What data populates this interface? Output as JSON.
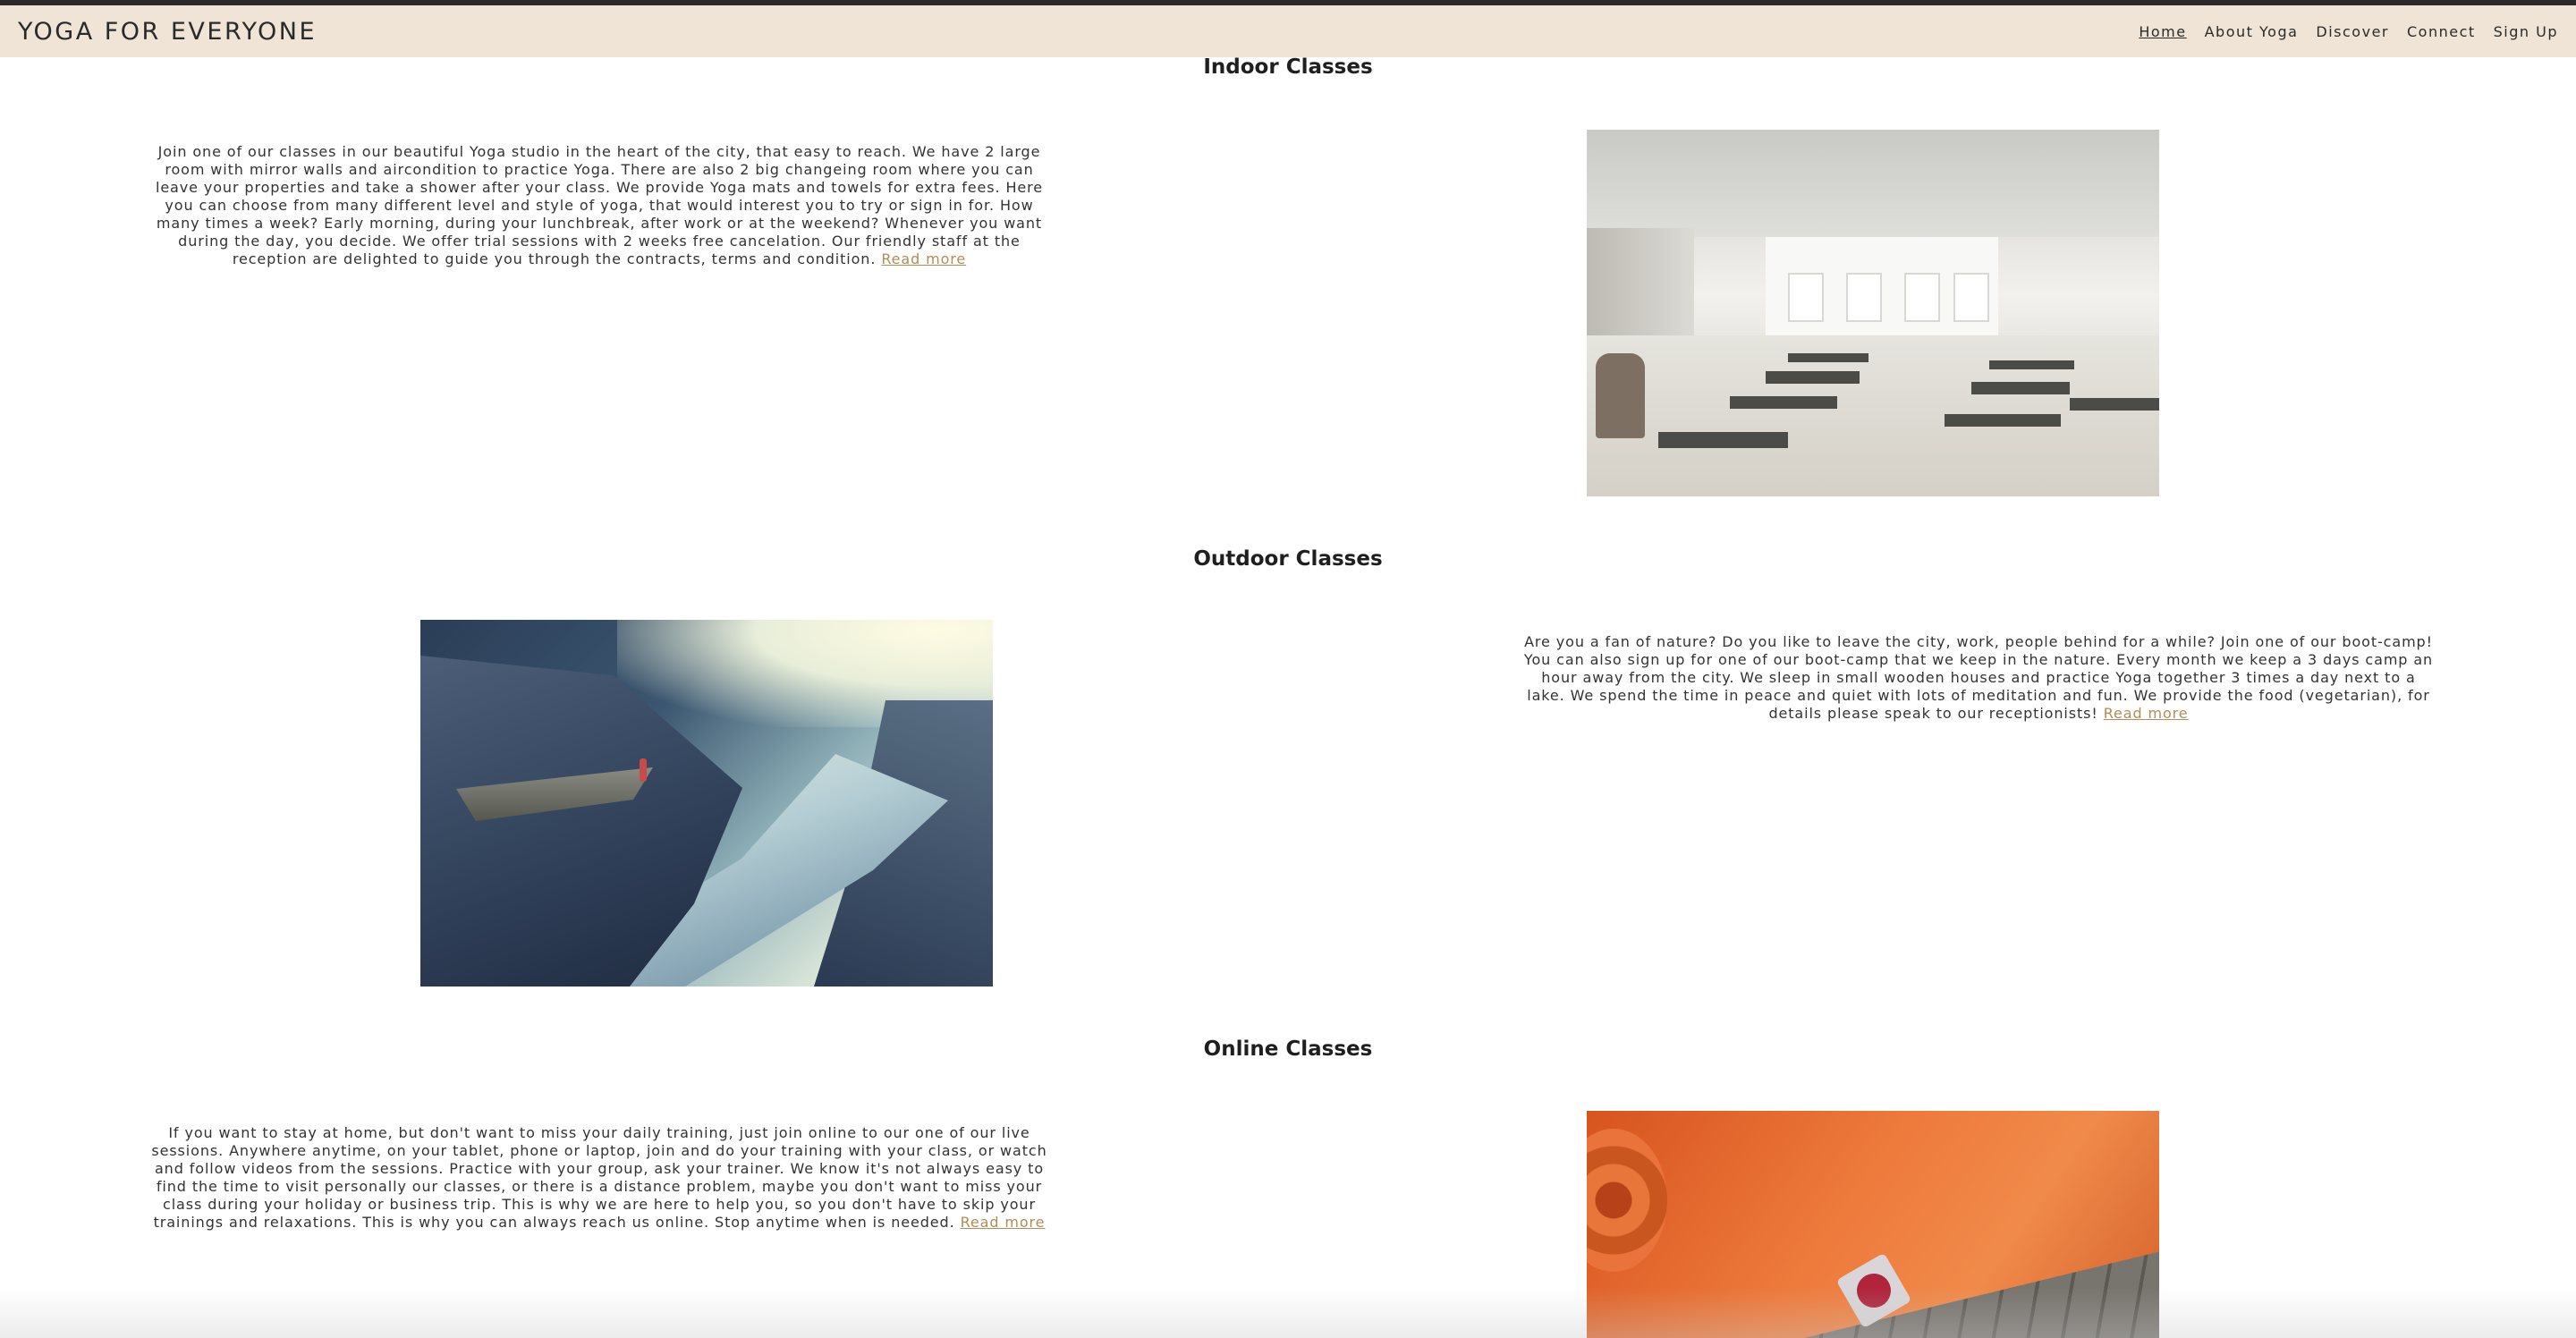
{
  "brand": "YOGA FOR EVERYONE",
  "nav": [
    {
      "label": "Home",
      "active": true
    },
    {
      "label": "About Yoga",
      "active": false
    },
    {
      "label": "Discover",
      "active": false
    },
    {
      "label": "Connect",
      "active": false
    },
    {
      "label": "Sign Up",
      "active": false
    }
  ],
  "sections": {
    "indoor": {
      "title": "Indoor Classes",
      "text": "Join one of our classes in our beautiful Yoga studio in the heart of the city, that easy to reach. We have 2 large room with mirror walls and aircondition to practice Yoga. There are also 2 big changeing room where you can leave your properties and take a shower after your class. We provide Yoga mats and towels for extra fees. Here you can choose from many different level and style of yoga, that would interest you to try or sign in for. How many times a week? Early morning, during your lunchbreak, after work or at the weekend? Whenever you want during the day, you decide. We offer trial sessions with 2 weeks free cancelation. Our friendly staff at the reception are delighted to guide you through the contracts, terms and condition.",
      "link": "Read more"
    },
    "outdoor": {
      "title": "Outdoor Classes",
      "text": "Are you a fan of nature? Do you like to leave the city, work, people behind for a while? Join one of our boot-camp! You can also sign up for one of our boot-camp that we keep in the nature. Every month we keep a 3 days camp an hour away from the city. We sleep in small wooden houses and practice Yoga together 3 times a day next to a lake. We spend the time in peace and quiet with lots of meditation and fun. We provide the food (vegetarian), for details please speak to our receptionists!",
      "link": "Read more"
    },
    "online": {
      "title": "Online Classes",
      "text": "If you want to stay at home, but don't want to miss your daily training, just join online to our one of our live sessions. Anywhere anytime, on your tablet, phone or laptop, join and do your training with your class, or watch and follow videos from the sessions. Practice with your group, ask your trainer. We know it's not always easy to find the time to visit personally our classes, or there is a distance problem, maybe you don't want to miss your class during your holiday or business trip. This is why we are here to help you, so you don't have to skip your trainings and relaxations. This is why you can always reach us online. Stop anytime when is needed.",
      "link": "Read more"
    }
  }
}
